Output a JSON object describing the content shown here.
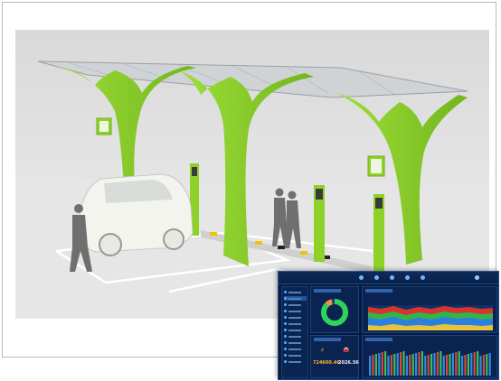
{
  "image": {
    "description_free": true,
    "colors": {
      "canopy_green": "#8ed12a",
      "canopy_shadow": "#6fae1a",
      "ground": "#e2e2e2",
      "dash_bg": "#071a3a"
    },
    "dashboard": {
      "nav_icons": [
        "home-icon",
        "chart-icon",
        "station-icon",
        "car-icon",
        "settings-icon"
      ],
      "sidebar_items": 12,
      "energy_value": "724600.46",
      "count_value": "2026.56"
    }
  }
}
